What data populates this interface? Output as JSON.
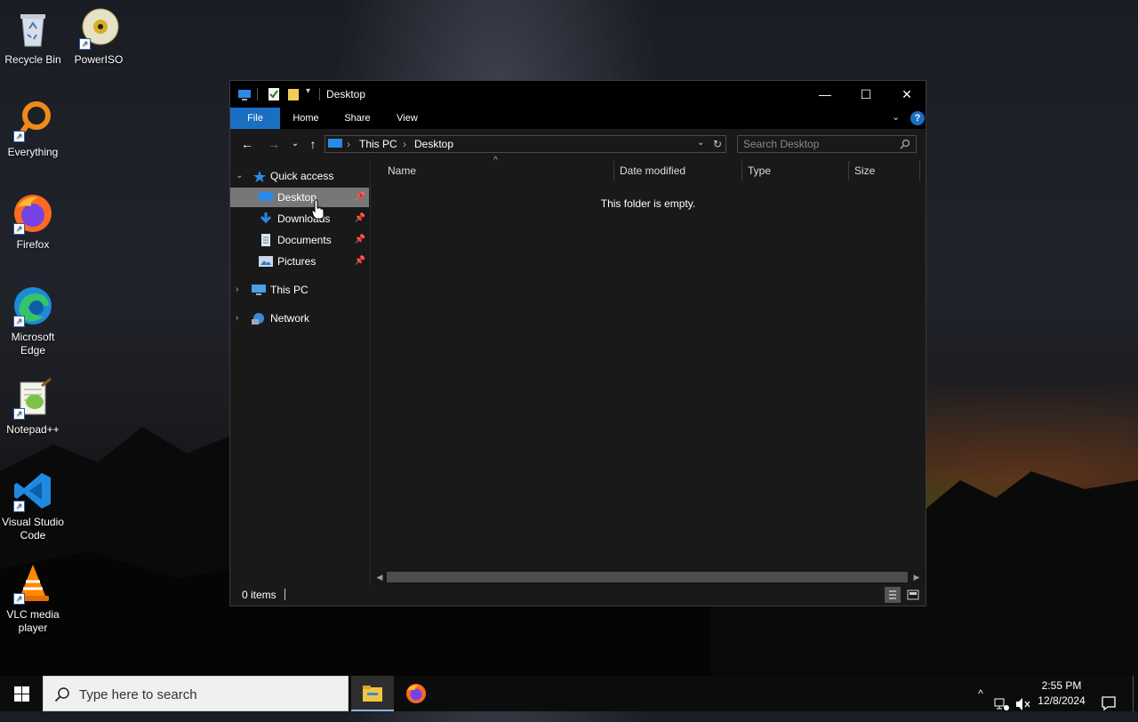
{
  "desktop": {
    "icons": [
      {
        "label": "Recycle Bin"
      },
      {
        "label": "PowerISO"
      },
      {
        "label": "Everything"
      },
      {
        "label": "Firefox"
      },
      {
        "label": "Microsoft Edge"
      },
      {
        "label": "Notepad++"
      },
      {
        "label": "Visual Studio Code"
      },
      {
        "label": "VLC media player"
      }
    ]
  },
  "window": {
    "title": "Desktop",
    "controls": {
      "minimize": "—",
      "maximize": "☐",
      "close": "✕"
    },
    "ribbon": {
      "tabs": [
        {
          "label": "File"
        },
        {
          "label": "Home"
        },
        {
          "label": "Share"
        },
        {
          "label": "View"
        }
      ],
      "help": "?"
    },
    "address": {
      "crumbs": [
        "This PC",
        "Desktop"
      ]
    },
    "search": {
      "placeholder": "Search Desktop"
    },
    "nav": {
      "quick_access": "Quick access",
      "items": [
        {
          "label": "Desktop",
          "pinned": true
        },
        {
          "label": "Downloads",
          "pinned": true
        },
        {
          "label": "Documents",
          "pinned": true
        },
        {
          "label": "Pictures",
          "pinned": true
        }
      ],
      "this_pc": "This PC",
      "network": "Network"
    },
    "columns": [
      {
        "label": "Name"
      },
      {
        "label": "Date modified"
      },
      {
        "label": "Type"
      },
      {
        "label": "Size"
      }
    ],
    "empty_message": "This folder is empty.",
    "status": {
      "items": "0 items"
    }
  },
  "taskbar": {
    "search_placeholder": "Type here to search",
    "clock": {
      "time": "2:55 PM",
      "date": "12/8/2024"
    }
  }
}
